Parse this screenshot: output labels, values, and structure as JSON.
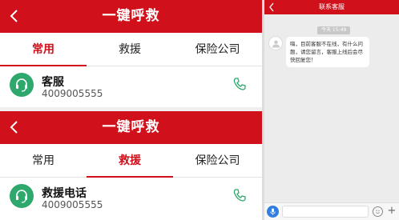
{
  "app": {
    "title": "一键呼救",
    "tabs": [
      "常用",
      "救援",
      "保险公司"
    ]
  },
  "panel1": {
    "active_tab": 0,
    "contact": {
      "name": "客服",
      "number": "4009005555"
    }
  },
  "panel2": {
    "active_tab": 1,
    "contact": {
      "name": "救援电话",
      "number": "4009005555"
    }
  },
  "chat": {
    "title": "联系客服",
    "timestamp": "今天 15:49",
    "message": "嗨，目前客服不在线，有什么问题，请您留言，客服上线后会尽快回复您！"
  },
  "colors": {
    "brand_red": "#d0101b",
    "avatar_green": "#2ea86c",
    "voice_blue": "#2f7ee0"
  },
  "icons": {
    "back": "chevron-left-icon",
    "headset": "headset-icon",
    "phone": "phone-icon",
    "voice": "microphone-icon",
    "emoji": "smiley-icon",
    "plus": "plus-icon"
  }
}
